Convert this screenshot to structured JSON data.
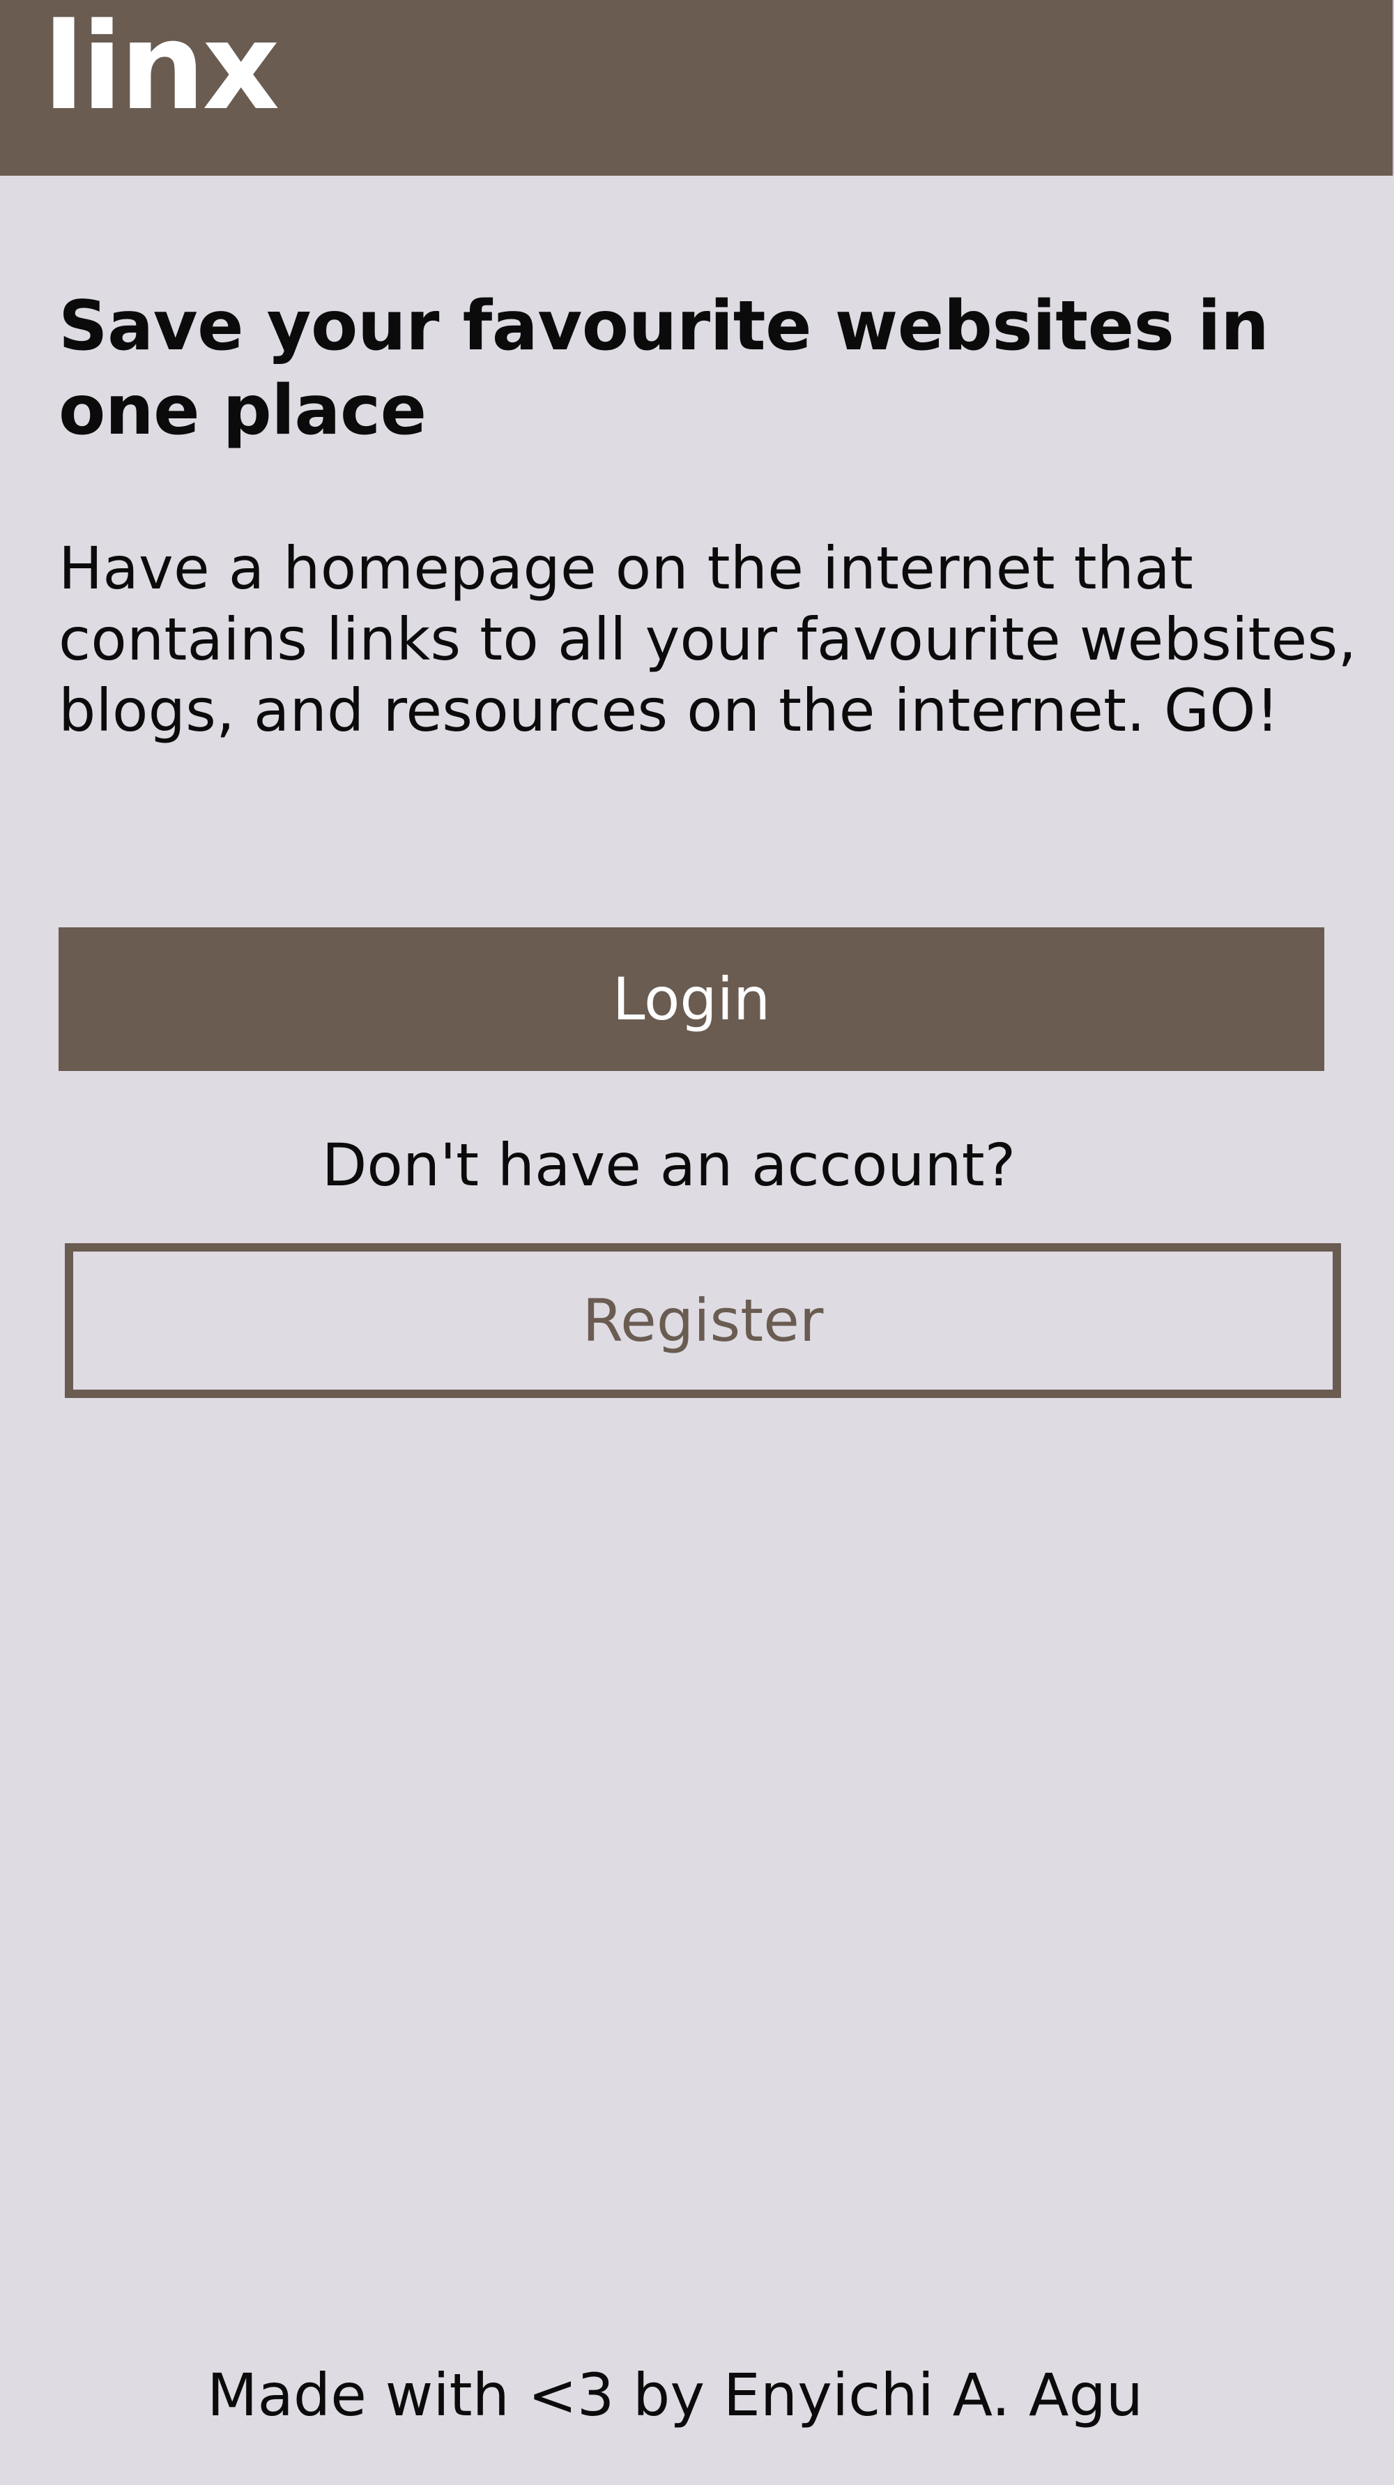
{
  "header": {
    "logo_text": "linx",
    "background_color": "#6a5c51"
  },
  "main": {
    "headline": "Save your favourite websites in one place",
    "description": "Have a homepage on the internet that contains links to all your favourite websites, blogs, and resources on the internet. GO!",
    "login_label": "Login",
    "account_prompt": "Don't have an account?",
    "register_label": "Register"
  },
  "footer": {
    "text": "Made with <3 by Enyichi A. Agu"
  },
  "colors": {
    "accent": "#6a5c51",
    "page_background": "#dedbe3",
    "text": "#0b0b0b"
  }
}
